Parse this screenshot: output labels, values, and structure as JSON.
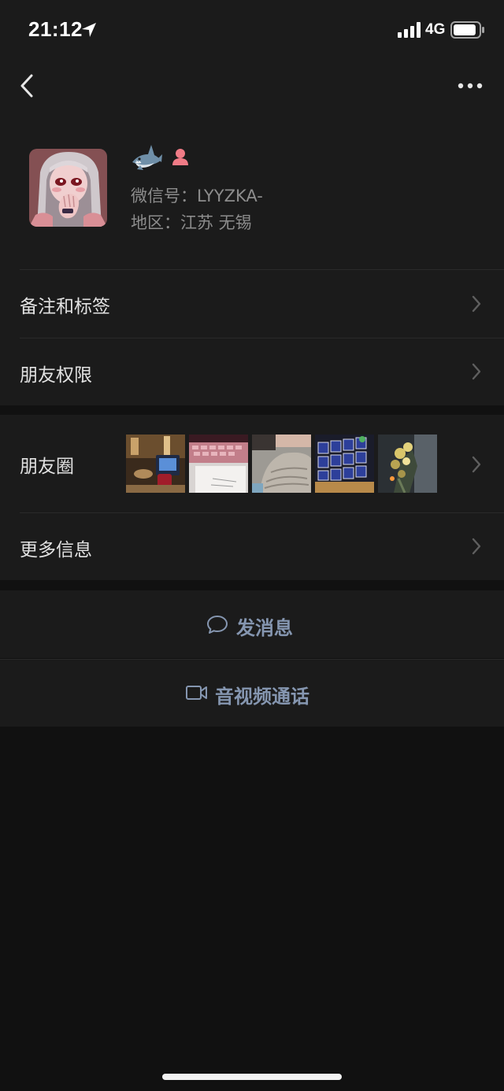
{
  "status_bar": {
    "time": "21:12",
    "network": "4G",
    "signal_bars": 4,
    "battery_level": 0.9
  },
  "nav": {
    "back_icon": "chevron-left-icon",
    "more_icon": "ellipsis-icon"
  },
  "profile": {
    "nickname_icon": "shark-emoji",
    "gender_icon": "female-icon",
    "wechat_id": "微信号：LYYZKA-",
    "region": "地区：江苏 无锡"
  },
  "rows": {
    "remarks_tags": "备注和标签",
    "friend_permissions": "朋友权限",
    "moments": "朋友圈",
    "more_info": "更多信息"
  },
  "actions": {
    "send_message": "发消息",
    "video_call": "音视频通话"
  },
  "colors": {
    "background": "#111111",
    "surface": "#1b1b1b",
    "action_text": "#8596b0",
    "secondary_text": "#8c8c8c"
  }
}
